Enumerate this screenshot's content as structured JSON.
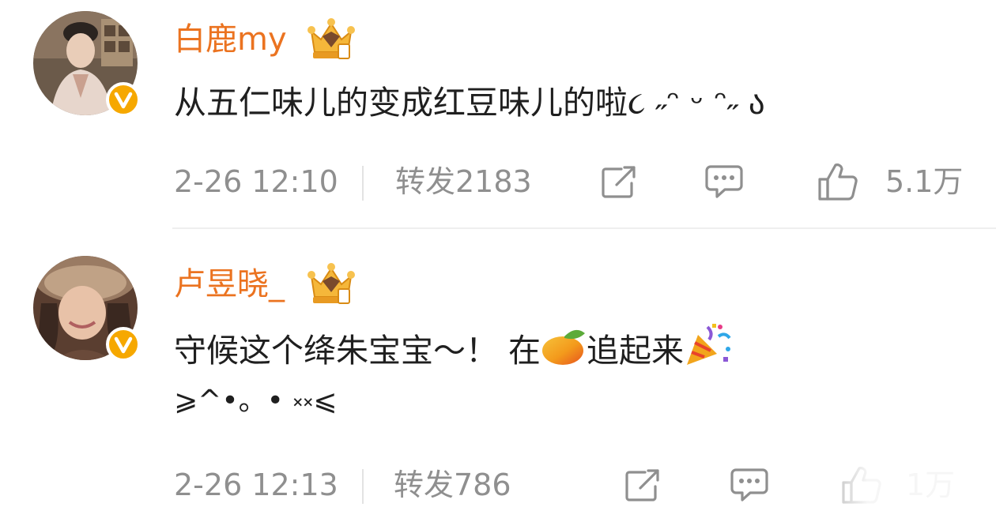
{
  "comments": [
    {
      "username": "白鹿my",
      "text": "从五仁味儿的变成红豆味儿的啦૮ ˶ᵔ ᵕ ᵔ˶ ა",
      "time": "2-26 12:10",
      "repost_label": "转发2183",
      "like_count": "5.1万"
    },
    {
      "username": "卢昱晓_",
      "text_line1_a": "守候这个绛朱宝宝～！ 在",
      "text_line1_b": "追起来",
      "text_line2": "⩾^•。• ༝༝⩽",
      "time": "2-26 12:13",
      "repost_label": "转发786",
      "like_count": "1万"
    }
  ],
  "colors": {
    "username": "#eb7320",
    "meta": "#8f8f8f",
    "verified_badge": "#f6a800"
  },
  "icons": [
    "crown-badge-icon",
    "verified-icon",
    "share-icon",
    "comment-icon",
    "like-icon",
    "mango-emoji-icon",
    "party-popper-emoji-icon"
  ]
}
